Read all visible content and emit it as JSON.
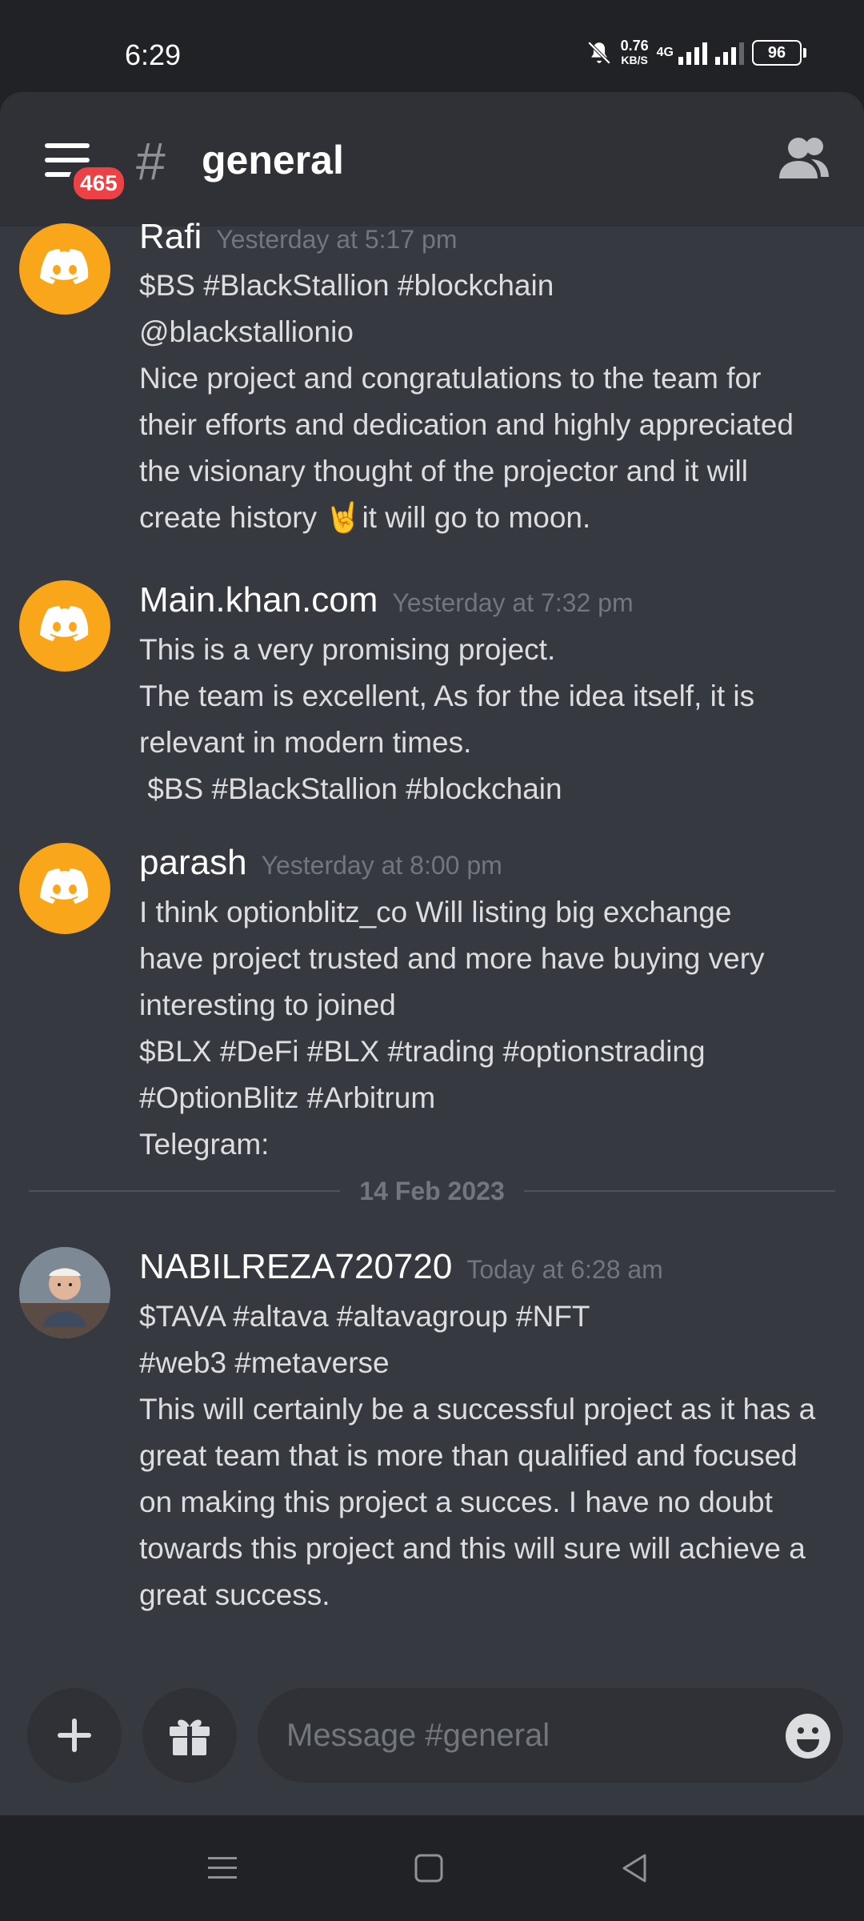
{
  "status_bar": {
    "time": "6:29",
    "net_speed_value": "0.76",
    "net_speed_unit": "KB/S",
    "network_type": "4G",
    "battery": "96"
  },
  "header": {
    "unread_badge": "465",
    "hash_symbol": "#",
    "channel_name": "general"
  },
  "messages": [
    {
      "author": "Rafi",
      "timestamp": "Yesterday at 5:17 pm",
      "lines": [
        "$BS #BlackStallion #blockchain",
        "@blackstallionio",
        "Nice project and congratulations to the team for",
        "their efforts and dedication and highly appreciated",
        "the visionary thought of the projector and it will",
        "create history 🤘it will go to moon."
      ]
    },
    {
      "author": "Main.khan.com",
      "timestamp": "Yesterday at 7:32 pm",
      "lines": [
        "This is a very promising project.",
        "The team is excellent, As for the idea itself, it is",
        "relevant in modern times.",
        " $BS #BlackStallion #blockchain"
      ]
    },
    {
      "author": "parash",
      "timestamp": "Yesterday at 8:00 pm",
      "lines": [
        "I think optionblitz_co Will listing big exchange",
        "have project trusted and more have buying very",
        "interesting to joined",
        "$BLX #DeFi #BLX #trading #optionstrading",
        "#OptionBlitz #Arbitrum",
        "Telegram:"
      ]
    },
    {
      "author": "NABILREZA720720",
      "timestamp": "Today at 6:28 am",
      "lines": [
        "$TAVA #altava #altavagroup #NFT",
        "#web3 #metaverse",
        "This will certainly be a successful project as it has a",
        "great team that is more than qualified and focused",
        "on making this project a succes. I have no doubt",
        "towards this project and this will sure will achieve a",
        "great success."
      ]
    }
  ],
  "date_divider": "14 Feb 2023",
  "composer": {
    "placeholder": "Message #general"
  },
  "colors": {
    "background": "#36393f",
    "header": "#2f3136",
    "avatar_default": "#faa61a",
    "badge": "#ed4245"
  },
  "icons": {
    "menu": "hamburger-icon",
    "members": "members-icon",
    "add": "plus-icon",
    "gift": "gift-icon",
    "emoji": "emoji-icon"
  }
}
